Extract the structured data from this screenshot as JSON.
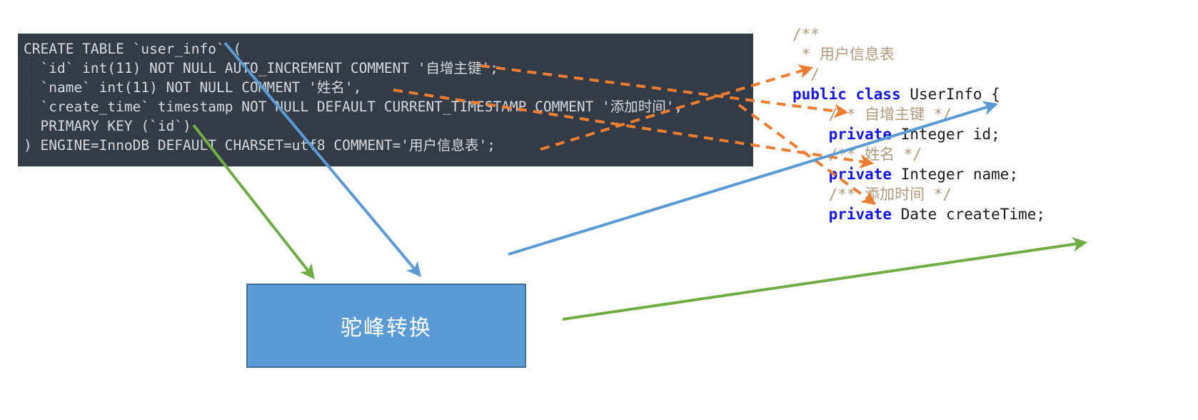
{
  "sql_block": {
    "name": "sql-create-table-statement",
    "background": "#333b47",
    "text_color": "#d6dae0",
    "lines": [
      "CREATE TABLE `user_info` (",
      "  `id` int(11) NOT NULL AUTO_INCREMENT COMMENT '自增主键';",
      "  `name` int(11) NOT NULL COMMENT '姓名',",
      "  `create_time` timestamp NOT NULL DEFAULT CURRENT_TIMESTAMP COMMENT '添加时间',",
      "  PRIMARY KEY (`id`)",
      ") ENGINE=InnoDB DEFAULT CHARSET=utf8 COMMENT='用户信息表';"
    ]
  },
  "java_block": {
    "name": "java-entity-class",
    "keyword_color": "#1414f0",
    "comment_color": "#b09a7c",
    "text_color": "#1a1a1a",
    "lines": [
      {
        "segments": [
          {
            "text": "/**",
            "style": "cmt"
          }
        ]
      },
      {
        "segments": [
          {
            "text": " * 用户信息表",
            "style": "cmt"
          }
        ]
      },
      {
        "segments": [
          {
            "text": " */",
            "style": "cmt"
          }
        ]
      },
      {
        "segments": [
          {
            "text": "public class",
            "style": "kw"
          },
          {
            "text": " UserInfo {",
            "style": "plain"
          }
        ]
      },
      {
        "segments": [
          {
            "text": "    /** 自增主键 */",
            "style": "cmt"
          }
        ]
      },
      {
        "segments": [
          {
            "text": "    ",
            "style": "plain"
          },
          {
            "text": "private",
            "style": "kw"
          },
          {
            "text": " Integer id;",
            "style": "plain"
          }
        ]
      },
      {
        "segments": [
          {
            "text": "    /** 姓名 */",
            "style": "cmt"
          }
        ]
      },
      {
        "segments": [
          {
            "text": "    ",
            "style": "plain"
          },
          {
            "text": "private",
            "style": "kw"
          },
          {
            "text": " Integer name;",
            "style": "plain"
          }
        ]
      },
      {
        "segments": [
          {
            "text": "    /** 添加时间 */",
            "style": "cmt"
          }
        ]
      },
      {
        "segments": [
          {
            "text": "    ",
            "style": "plain"
          },
          {
            "text": "private",
            "style": "kw"
          },
          {
            "text": " Date createTime;",
            "style": "plain"
          }
        ]
      }
    ]
  },
  "camel_box": {
    "label": "驼峰转换",
    "fill": "#5b9bd5",
    "border": "#41719c",
    "text_color": "#ffffff"
  },
  "arrows": {
    "orange_color": "#ed7d31",
    "blue_color": "#5b9bd5",
    "green_color": "#70ad47",
    "mapping_notes": [
      "table comment '用户信息表' → class javadoc 用户信息表",
      "column comment '自增主键' → field javadoc 自增主键",
      "column comment '姓名' → field javadoc 姓名",
      "column comment '添加时间' → field javadoc 添加时间",
      "table name user_info → class name UserInfo (via 驼峰转换)",
      "column create_time → field createTime (via 驼峰转换)"
    ]
  }
}
